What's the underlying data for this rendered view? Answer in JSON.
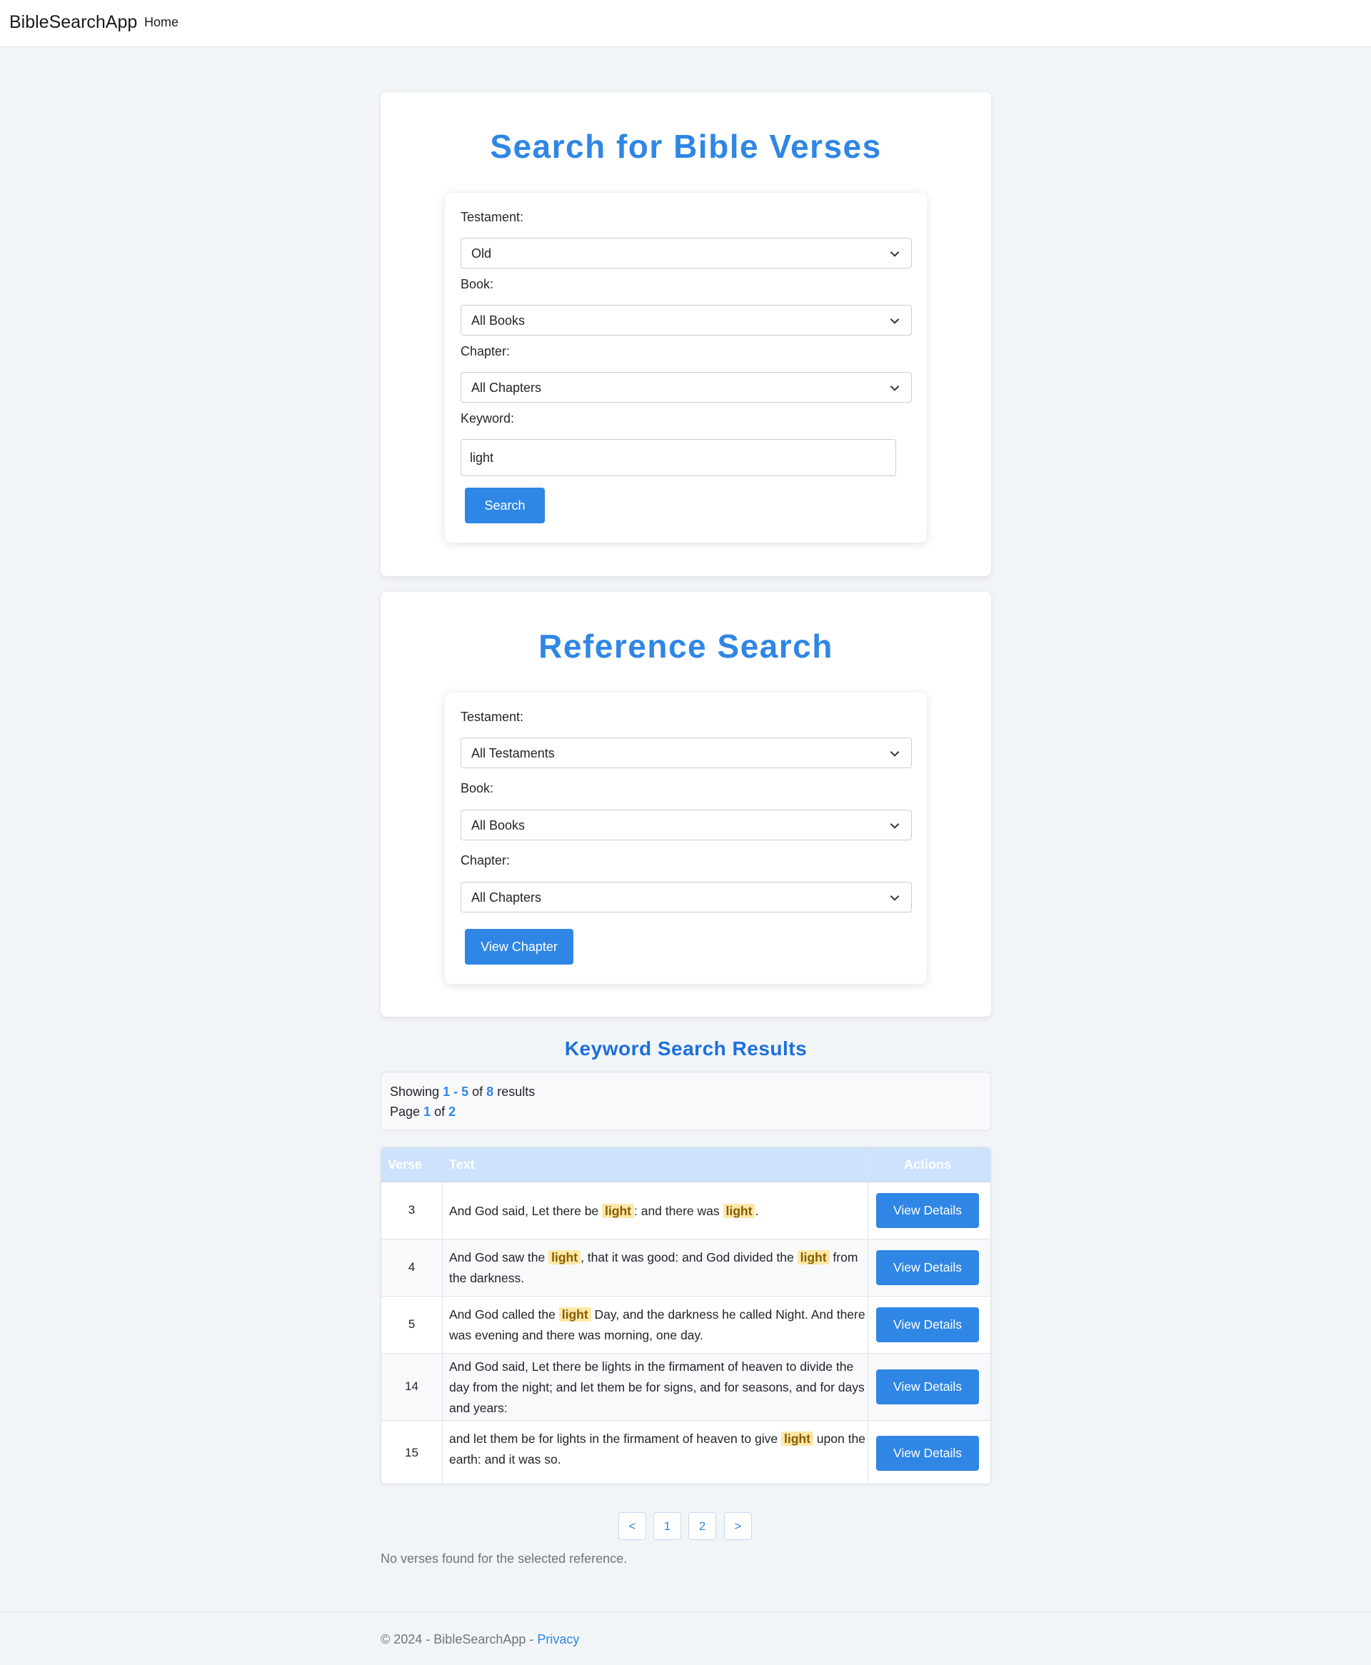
{
  "nav": {
    "brand": "BibleSearchApp",
    "home": "Home"
  },
  "search": {
    "title": "Search for Bible Verses",
    "testament_label": "Testament:",
    "testament_value": "Old",
    "book_label": "Book:",
    "book_value": "All Books",
    "chapter_label": "Chapter:",
    "chapter_value": "All Chapters",
    "keyword_label": "Keyword:",
    "keyword_value": "light",
    "button": "Search"
  },
  "reference": {
    "title": "Reference Search",
    "testament_label": "Testament:",
    "testament_value": "All Testaments",
    "book_label": "Book:",
    "book_value": "All Books",
    "chapter_label": "Chapter:",
    "chapter_value": "All Chapters",
    "button": "View Chapter"
  },
  "results": {
    "title": "Keyword Search Results",
    "showing_prefix": "Showing",
    "range_start": "1",
    "range_sep": "-",
    "range_end": "5",
    "of_word": "of",
    "total": "8",
    "results_word": "results",
    "page_word": "Page",
    "page_current": "1",
    "page_of": "of",
    "page_total": "2",
    "columns": {
      "verse": "Verse",
      "text": "Text",
      "actions": "Actions"
    },
    "rows": [
      {
        "verse": "3",
        "segments": [
          "And God said, Let there be ",
          "light",
          ": and there was ",
          "light",
          "."
        ],
        "action": "View Details"
      },
      {
        "verse": "4",
        "segments": [
          "And God saw the ",
          "light",
          ", that it was good: and God divided the ",
          "light",
          " from the darkness."
        ],
        "action": "View Details"
      },
      {
        "verse": "5",
        "segments": [
          "And God called the ",
          "light",
          " Day, and the darkness he called Night. And there was evening and there was morning, one day."
        ],
        "action": "View Details"
      },
      {
        "verse": "14",
        "segments": [
          "And God said, Let there be lights in the firmament of heaven to divide the day from the night; and let them be for signs, and for seasons, and for days and years:"
        ],
        "action": "View Details"
      },
      {
        "verse": "15",
        "segments": [
          "and let them be for lights in the firmament of heaven to give ",
          "light",
          " upon the earth: and it was so."
        ],
        "action": "View Details"
      }
    ]
  },
  "pagination": {
    "prev": "<",
    "pages": [
      "1",
      "2"
    ],
    "next": ">"
  },
  "reference_empty": "No verses found for the selected reference.",
  "footer": {
    "text": "© 2024 - BibleSearchApp - ",
    "privacy": "Privacy"
  },
  "colors": {
    "accent": "#2f86e5",
    "highlight": "#fde8a8",
    "header_bg": "#cde2fc"
  },
  "icons": {
    "select_arrow": "chevron-down-icon"
  }
}
